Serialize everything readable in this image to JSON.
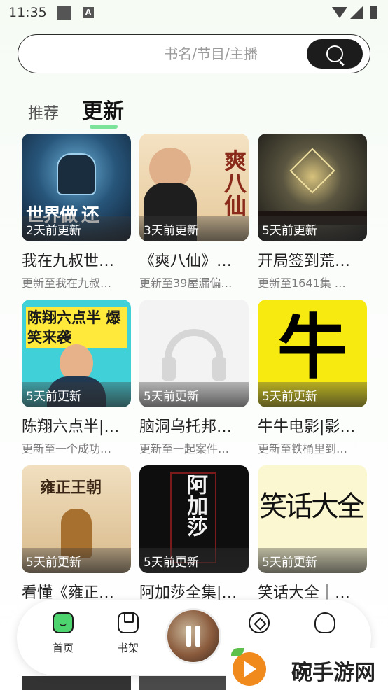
{
  "status": {
    "time": "11:35",
    "a_icon": "A"
  },
  "search": {
    "placeholder": "书名/节目/主播",
    "button_icon": "search-icon"
  },
  "tabs": [
    {
      "label": "推荐",
      "active": false
    },
    {
      "label": "更新",
      "active": true
    }
  ],
  "accent_color": "#7be39a",
  "books": [
    {
      "badge": "2天前更新",
      "title": "我在九叔世…",
      "sub": "更新至我在九叔…",
      "cover_text": "世界做 还"
    },
    {
      "badge": "3天前更新",
      "title": "《爽八仙》…",
      "sub": "更新至39屋漏偏…",
      "cover_text": "爽八仙"
    },
    {
      "badge": "5天前更新",
      "title": "开局签到荒…",
      "sub": "更新至1641集 …",
      "cover_text": ""
    },
    {
      "badge": "5天前更新",
      "title": "陈翔六点半|…",
      "sub": "更新至一个成功…",
      "cover_text": "陈翔六点半 爆笑来袭"
    },
    {
      "badge": "5天前更新",
      "title": "脑洞乌托邦…",
      "sub": "更新至一起案件…",
      "cover_text": ""
    },
    {
      "badge": "5天前更新",
      "title": "牛牛电影|影…",
      "sub": "更新至铁桶里到…",
      "cover_text": "牛"
    },
    {
      "badge": "5天前更新",
      "title": "看懂《雍正…",
      "sub": "",
      "cover_text": "雍正王朝"
    },
    {
      "badge": "5天前更新",
      "title": "阿加莎全集|…",
      "sub": "",
      "cover_text": "阿加莎"
    },
    {
      "badge": "5天前更新",
      "title": "笑话大全｜…",
      "sub": "",
      "cover_text": "笑话大全"
    }
  ],
  "nav": {
    "home": "首页",
    "shelf": "书架"
  },
  "watermark": {
    "text": "碗手游网"
  }
}
